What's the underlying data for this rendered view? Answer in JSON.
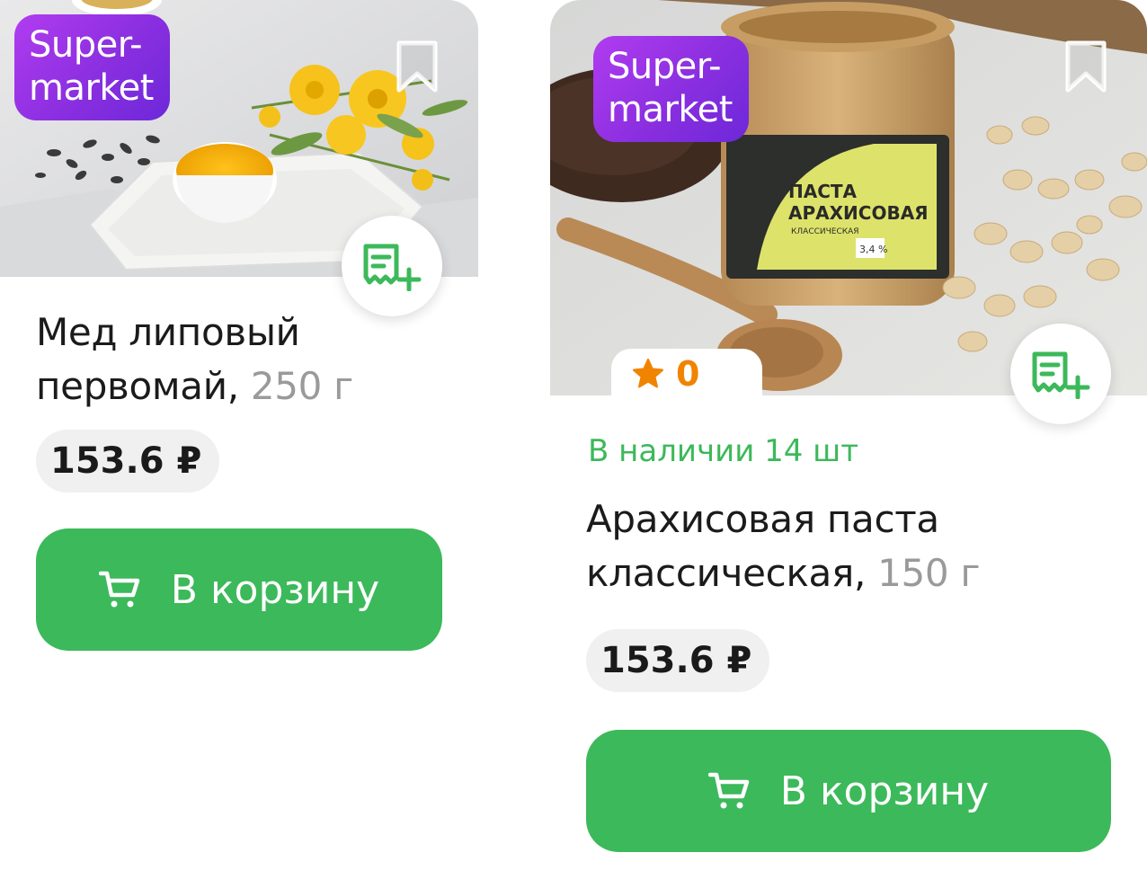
{
  "colors": {
    "accent_green": "#3cb95a",
    "badge_purple": "#8a2fe0",
    "rating_orange": "#f08400",
    "price_bg": "#f0f0f0",
    "weight_gray": "#9a9a9a"
  },
  "products": [
    {
      "badge": "Super-\nmarket",
      "photo": "honey-photo",
      "title": "Мед липовый первомай,",
      "weight": "250 г",
      "price": "153.6 ₽",
      "cart_label": "В корзину",
      "icons": [
        "bookmark-icon",
        "add-to-list-icon",
        "cart-icon"
      ]
    },
    {
      "badge": "Super-\nmarket",
      "photo": "peanut-butter-photo",
      "rating": "0",
      "stock": "В наличии 14 шт",
      "title": "Арахисовая паста классическая,",
      "weight": "150 г",
      "price": "153.6 ₽",
      "cart_label": "В корзину",
      "icons": [
        "bookmark-icon",
        "star-icon",
        "add-to-list-icon",
        "cart-icon"
      ]
    }
  ]
}
